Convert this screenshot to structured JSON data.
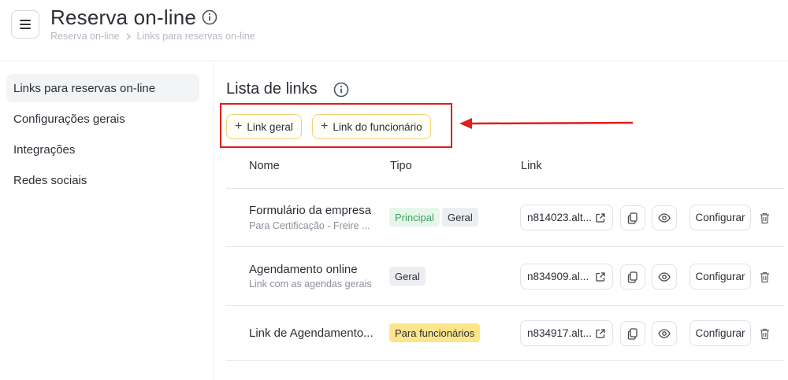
{
  "header": {
    "title": "Reserva on-line",
    "breadcrumb": [
      "Reserva on-line",
      "Links para reservas on-line"
    ]
  },
  "sidebar": {
    "items": [
      {
        "label": "Links para reservas on-line",
        "active": true
      },
      {
        "label": "Configurações gerais",
        "active": false
      },
      {
        "label": "Integrações",
        "active": false
      },
      {
        "label": "Redes sociais",
        "active": false
      }
    ]
  },
  "main": {
    "section_title": "Lista de links",
    "buttons": {
      "link_geral": "Link geral",
      "link_funcionario": "Link do funcionário"
    },
    "columns": [
      "Nome",
      "Tipo",
      "Link"
    ],
    "rows": [
      {
        "name": "Formulário da empresa",
        "subtitle": "Para Certificação - Freire ...",
        "badges": [
          "Principal",
          "Geral"
        ],
        "link": "n814023.alt...",
        "configure": "Configurar"
      },
      {
        "name": "Agendamento online",
        "subtitle": "Link com as agendas gerais",
        "badges": [
          "Geral"
        ],
        "link": "n834909.al...",
        "configure": "Configurar"
      },
      {
        "name": "Link de Agendamento...",
        "subtitle": "",
        "badges": [
          "Para funcionários"
        ],
        "link": "n834917.alt...",
        "configure": "Configurar"
      }
    ]
  },
  "colors": {
    "highlight": "#e11d1d",
    "button_border": "#f2d277",
    "badge_principal_bg": "#e7f6ea",
    "badge_principal_text": "#3aa35a",
    "badge_funcionarios_bg": "#fde68a"
  }
}
